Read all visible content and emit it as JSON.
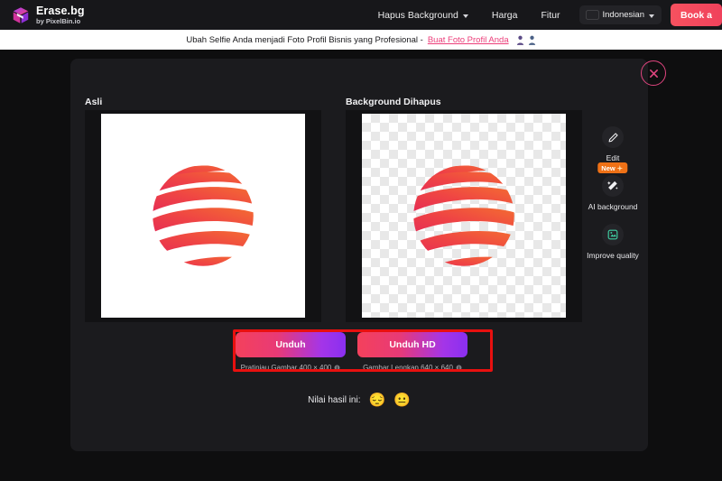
{
  "brand": {
    "title": "Erase.bg",
    "subtitle": "by PixelBin.io",
    "logo_icon": "cube-logo-icon"
  },
  "topnav": {
    "items": [
      {
        "label": "Hapus Background",
        "has_caret": true
      },
      {
        "label": "Harga",
        "has_caret": false
      },
      {
        "label": "Fitur",
        "has_caret": false
      }
    ],
    "language": {
      "label": "Indonesian",
      "flag": "indonesia-flag-icon"
    },
    "cta_label": "Book a"
  },
  "banner": {
    "text": "Ubah Selfie Anda menjadi Foto Profil Bisnis yang Profesional -",
    "link_label": "Buat Foto Profil Anda",
    "avatar_icons": [
      "person-avatar-icon",
      "person-avatar-icon"
    ]
  },
  "modal": {
    "close_icon": "close-icon",
    "original_label": "Asli",
    "removed_label": "Background Dihapus",
    "original_image_name": "striped-globe-logo",
    "removed_image_name": "striped-globe-logo-transparent"
  },
  "tools": [
    {
      "label": "Edit",
      "icon": "pencil-icon",
      "badge": null
    },
    {
      "label": "AI background",
      "icon": "magic-wand-icon",
      "badge": "New"
    },
    {
      "label": "Improve quality",
      "icon": "enhance-image-icon",
      "badge": null
    }
  ],
  "downloads": [
    {
      "label": "Unduh",
      "sub": "Pratinjau Gambar 400 × 400"
    },
    {
      "label": "Unduh HD",
      "sub": "Gambar Lengkap 640 × 640"
    }
  ],
  "rating": {
    "label": "Nilai hasil ini:",
    "options": [
      "😔",
      "😐"
    ]
  },
  "colors": {
    "accent_pink": "#ec3e7a",
    "accent_red": "#f4415c",
    "accent_purple": "#8a2ff0",
    "badge_orange": "#ef7116",
    "annotation_red": "#e8100f",
    "page_bg": "#0e0e0f",
    "modal_bg": "#1b1b1e"
  }
}
